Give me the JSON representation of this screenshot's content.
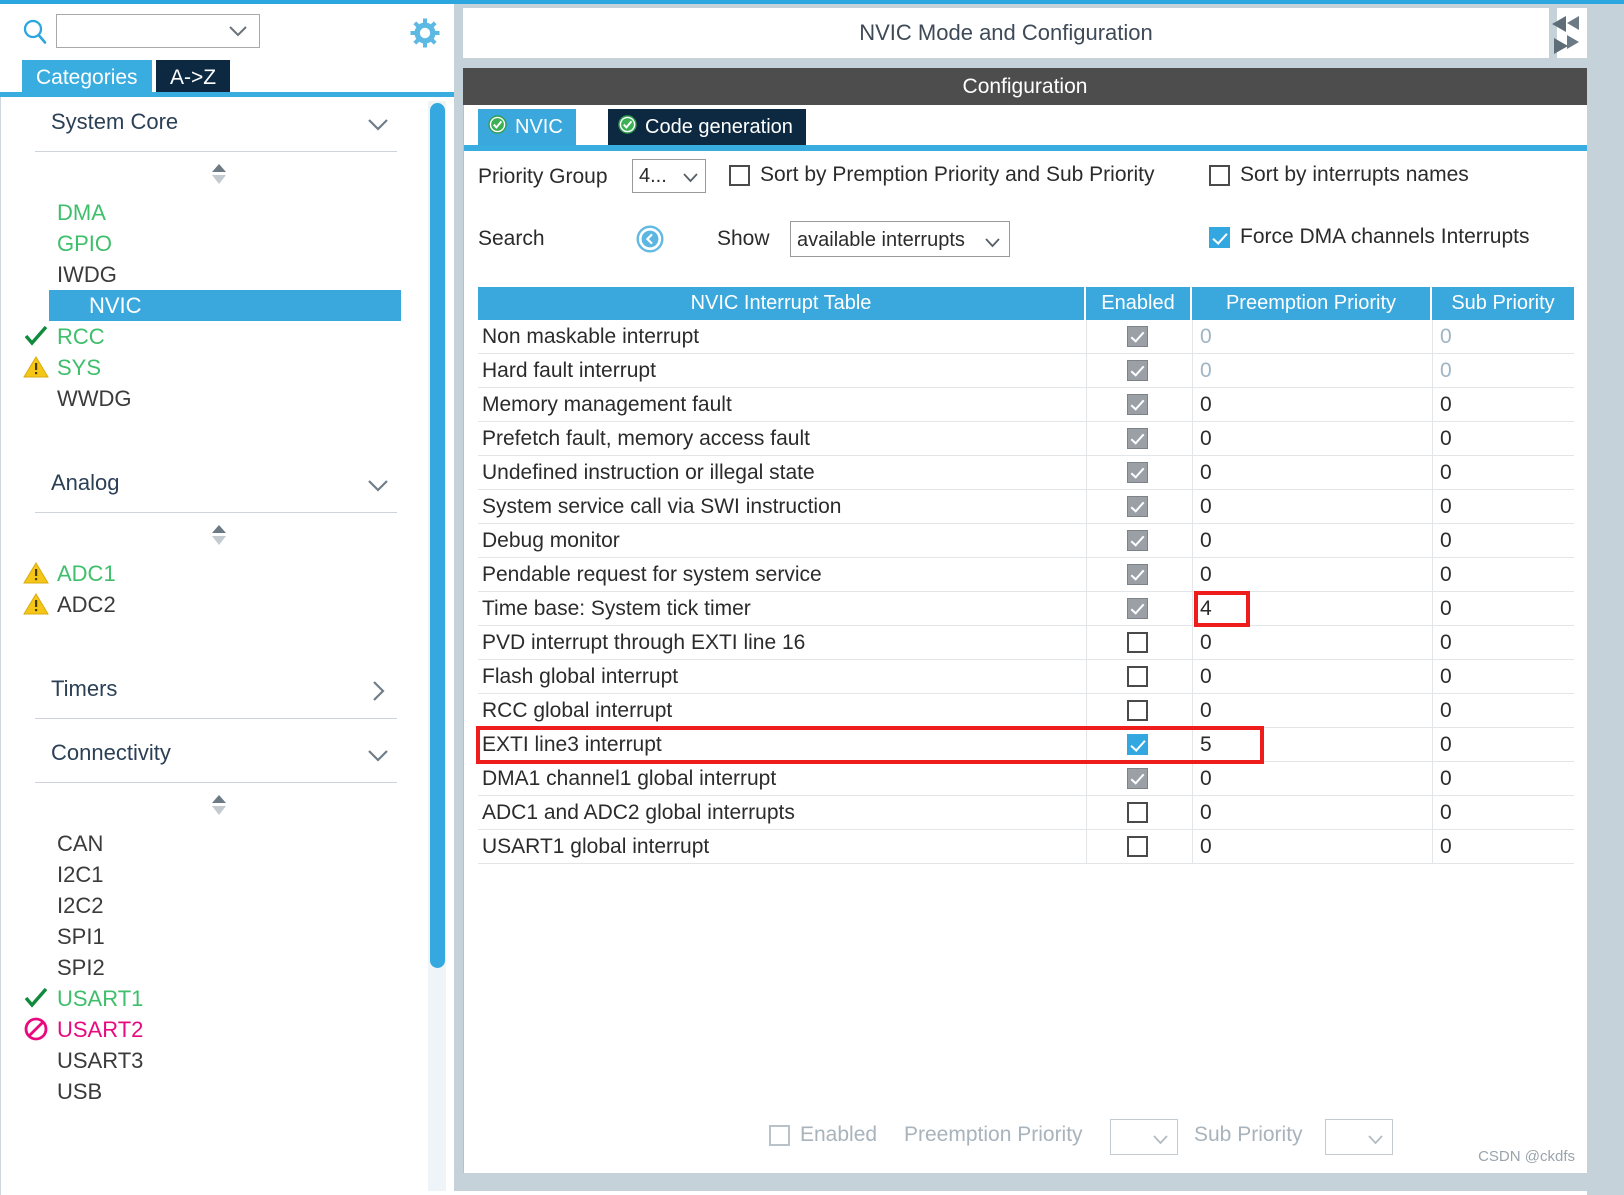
{
  "left_panel": {
    "search": {
      "value": "",
      "placeholder": ""
    },
    "icons": {
      "search": "search-icon",
      "gear": "gear-icon",
      "chevron": "chevron-down-icon"
    },
    "tabs": [
      {
        "label": "Categories",
        "active": true
      },
      {
        "label": "A->Z",
        "active": false
      }
    ],
    "categories": [
      {
        "title": "System Core",
        "arrow": "chevron-down-icon",
        "expanded": true,
        "items": [
          {
            "label": "DMA",
            "status": "configured",
            "color": "#3fbf6b",
            "icon": "",
            "selected": false
          },
          {
            "label": "GPIO",
            "status": "configured",
            "color": "#3fbf6b",
            "icon": "",
            "selected": false
          },
          {
            "label": "IWDG",
            "status": "none",
            "color": "#3b3b3b",
            "icon": "",
            "selected": false
          },
          {
            "label": "NVIC",
            "status": "selected",
            "color": "#ffffff",
            "icon": "",
            "selected": true
          },
          {
            "label": "RCC",
            "status": "ok",
            "color": "#3fbf6b",
            "icon": "check-icon",
            "selected": false
          },
          {
            "label": "SYS",
            "status": "warning",
            "color": "#3fbf6b",
            "icon": "warning-icon",
            "selected": false
          },
          {
            "label": "WWDG",
            "status": "none",
            "color": "#3b3b3b",
            "icon": "",
            "selected": false
          }
        ]
      },
      {
        "title": "Analog",
        "arrow": "chevron-down-icon",
        "expanded": true,
        "items": [
          {
            "label": "ADC1",
            "status": "warning",
            "color": "#3fbf6b",
            "icon": "warning-icon",
            "selected": false
          },
          {
            "label": "ADC2",
            "status": "warning",
            "color": "#3b3b3b",
            "icon": "warning-icon",
            "selected": false
          }
        ]
      },
      {
        "title": "Timers",
        "arrow": "chevron-right-icon",
        "expanded": false,
        "items": []
      },
      {
        "title": "Connectivity",
        "arrow": "chevron-down-icon",
        "expanded": true,
        "items": [
          {
            "label": "CAN",
            "status": "none",
            "color": "#3b3b3b",
            "icon": "",
            "selected": false
          },
          {
            "label": "I2C1",
            "status": "none",
            "color": "#3b3b3b",
            "icon": "",
            "selected": false
          },
          {
            "label": "I2C2",
            "status": "none",
            "color": "#3b3b3b",
            "icon": "",
            "selected": false
          },
          {
            "label": "SPI1",
            "status": "none",
            "color": "#3b3b3b",
            "icon": "",
            "selected": false
          },
          {
            "label": "SPI2",
            "status": "none",
            "color": "#3b3b3b",
            "icon": "",
            "selected": false
          },
          {
            "label": "USART1",
            "status": "ok",
            "color": "#3fbf6b",
            "icon": "check-icon",
            "selected": false
          },
          {
            "label": "USART2",
            "status": "unavailable",
            "color": "#e8097f",
            "icon": "blocked-icon",
            "selected": false
          },
          {
            "label": "USART3",
            "status": "none",
            "color": "#3b3b3b",
            "icon": "",
            "selected": false
          },
          {
            "label": "USB",
            "status": "none",
            "color": "#3b3b3b",
            "icon": "",
            "selected": false
          }
        ]
      }
    ]
  },
  "right_panel": {
    "mode_title": "NVIC Mode and Configuration",
    "configuration_title": "Configuration",
    "tabs": [
      {
        "label": "NVIC",
        "active": true,
        "icon": "check-circle-icon"
      },
      {
        "label": "Code generation",
        "active": false,
        "icon": "check-circle-icon"
      }
    ],
    "options": {
      "priority_group_label": "Priority Group",
      "priority_group_value": "4...",
      "sort_by_premption_label": "Sort by Premption Priority and Sub Priority",
      "sort_by_premption_checked": false,
      "sort_by_names_label": "Sort by interrupts names",
      "sort_by_names_checked": false,
      "search_label": "Search",
      "search_icon": "circle-left-chevron-icon",
      "show_label": "Show",
      "show_value": "available interrupts",
      "force_dma_label": "Force DMA channels Interrupts",
      "force_dma_checked": true
    },
    "table": {
      "columns": [
        "NVIC Interrupt Table",
        "Enabled",
        "Preemption Priority",
        "Sub Priority"
      ],
      "rows": [
        {
          "name": "Non maskable interrupt",
          "enabled": "locked",
          "preemption": "0",
          "sub": "0",
          "dim": true
        },
        {
          "name": "Hard fault interrupt",
          "enabled": "locked",
          "preemption": "0",
          "sub": "0",
          "dim": true
        },
        {
          "name": "Memory management fault",
          "enabled": "locked",
          "preemption": "0",
          "sub": "0",
          "dim": false
        },
        {
          "name": "Prefetch fault, memory access fault",
          "enabled": "locked",
          "preemption": "0",
          "sub": "0",
          "dim": false
        },
        {
          "name": "Undefined instruction or illegal state",
          "enabled": "locked",
          "preemption": "0",
          "sub": "0",
          "dim": false
        },
        {
          "name": "System service call via SWI instruction",
          "enabled": "locked",
          "preemption": "0",
          "sub": "0",
          "dim": false
        },
        {
          "name": "Debug monitor",
          "enabled": "locked",
          "preemption": "0",
          "sub": "0",
          "dim": false
        },
        {
          "name": "Pendable request for system service",
          "enabled": "locked",
          "preemption": "0",
          "sub": "0",
          "dim": false
        },
        {
          "name": "Time base: System tick timer",
          "enabled": "locked",
          "preemption": "4",
          "sub": "0",
          "dim": false,
          "highlight_preemption": true
        },
        {
          "name": "PVD interrupt through EXTI line 16",
          "enabled": "off",
          "preemption": "0",
          "sub": "0",
          "dim": false
        },
        {
          "name": "Flash global interrupt",
          "enabled": "off",
          "preemption": "0",
          "sub": "0",
          "dim": false
        },
        {
          "name": "RCC global interrupt",
          "enabled": "off",
          "preemption": "0",
          "sub": "0",
          "dim": false
        },
        {
          "name": "EXTI line3 interrupt",
          "enabled": "on",
          "preemption": "5",
          "sub": "0",
          "dim": false,
          "highlight_row": true
        },
        {
          "name": "DMA1 channel1 global interrupt",
          "enabled": "locked",
          "preemption": "0",
          "sub": "0",
          "dim": false
        },
        {
          "name": "ADC1 and ADC2 global interrupts",
          "enabled": "off",
          "preemption": "0",
          "sub": "0",
          "dim": false
        },
        {
          "name": "USART1 global interrupt",
          "enabled": "off",
          "preemption": "0",
          "sub": "0",
          "dim": false
        }
      ]
    },
    "footer": {
      "enabled_label": "Enabled",
      "enabled_checked": false,
      "preemption_label": "Preemption Priority",
      "preemption_value": "",
      "sub_label": "Sub Priority",
      "sub_value": ""
    }
  },
  "watermark": "CSDN @ckdfs",
  "colors": {
    "accent_blue": "#3ba8dd",
    "dark_navy": "#0d2942",
    "header_gray": "#4d4d4d",
    "highlight_red": "#ef1c1c",
    "green": "#3fbf6b",
    "pink": "#e8097f",
    "warn_yellow": "#f5c518"
  }
}
